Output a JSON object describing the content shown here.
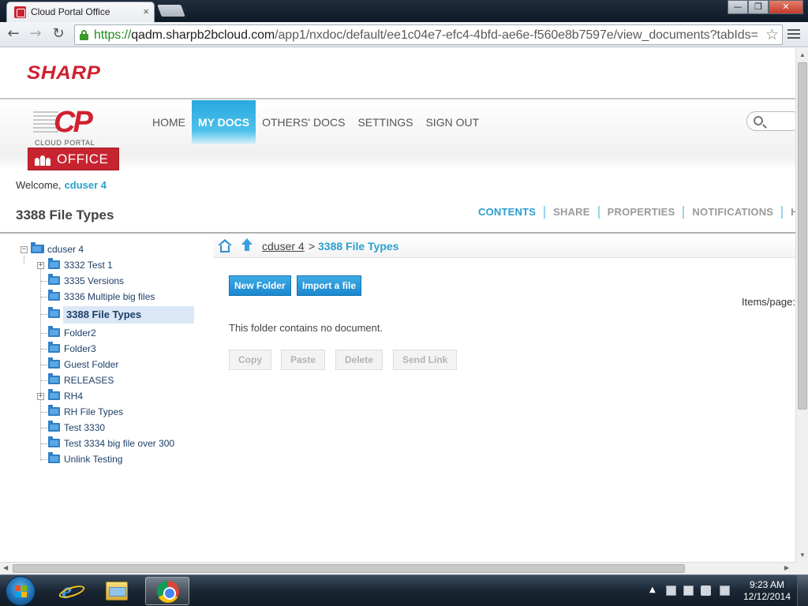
{
  "browser": {
    "tab_title": "Cloud Portal Office",
    "tab_close": "×",
    "url_scheme": "https://",
    "url_host": "qadm.sharpb2bcloud.com",
    "url_path": "/app1/nxdoc/default/ee1c04e7-efc4-4bfd-ae6e-f560e8b7597e/view_documents?tabIds=",
    "back_glyph": "←",
    "forward_glyph": "→",
    "reload_glyph": "↻",
    "star_glyph": "☆",
    "window_minimize": "—",
    "window_restore": "❐",
    "window_close": "✕"
  },
  "brand": {
    "sharp": "SHARP",
    "cp_letters": "CP",
    "cp_caption": "CLOUD PORTAL",
    "office": "OFFICE"
  },
  "nav": {
    "items": [
      {
        "label": "HOME",
        "active": false
      },
      {
        "label": "MY DOCS",
        "active": true
      },
      {
        "label": "OTHERS' DOCS",
        "active": false
      },
      {
        "label": "SETTINGS",
        "active": false
      },
      {
        "label": "SIGN OUT",
        "active": false
      }
    ]
  },
  "welcome": {
    "prefix": "Welcome,",
    "user": "cduser 4"
  },
  "page": {
    "title": "3388 File Types"
  },
  "content_tabs": [
    "CONTENTS",
    "SHARE",
    "PROPERTIES",
    "NOTIFICATIONS",
    "HI"
  ],
  "tree": {
    "root": "cduser 4",
    "children": [
      {
        "label": "3332 Test 1",
        "expandable": true
      },
      {
        "label": "3335 Versions",
        "expandable": false
      },
      {
        "label": "3336 Multiple big files",
        "expandable": false
      },
      {
        "label": "3388 File Types",
        "expandable": false,
        "selected": true
      },
      {
        "label": "Folder2",
        "expandable": false
      },
      {
        "label": "Folder3",
        "expandable": false
      },
      {
        "label": "Guest Folder",
        "expandable": false
      },
      {
        "label": "RELEASES",
        "expandable": false
      },
      {
        "label": "RH4",
        "expandable": true
      },
      {
        "label": "RH File Types",
        "expandable": false
      },
      {
        "label": "Test 3330",
        "expandable": false
      },
      {
        "label": "Test 3334 big file over 300",
        "expandable": false
      },
      {
        "label": "Unlink Testing",
        "expandable": false
      }
    ]
  },
  "breadcrumb": {
    "parent": "cduser 4",
    "separator": ">",
    "current": "3388 File Types"
  },
  "actions": {
    "new_folder": "New Folder",
    "import_file": "Import a file",
    "items_per_page": "Items/page:"
  },
  "documents": {
    "empty_message": "This folder contains no document."
  },
  "bulk_actions": [
    "Copy",
    "Paste",
    "Delete",
    "Send Link"
  ],
  "taskbar": {
    "time": "9:23 AM",
    "date": "12/12/2014",
    "tray_expand": "▲"
  },
  "colors": {
    "brand_red": "#d1202f",
    "accent_blue": "#2a9fd0",
    "nav_active": "#2eaee0"
  }
}
